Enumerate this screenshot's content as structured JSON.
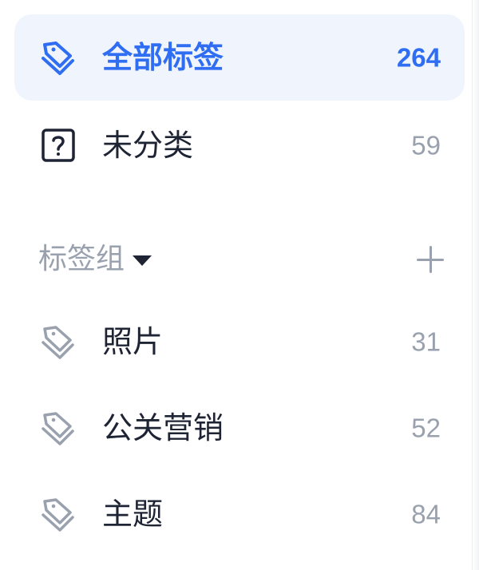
{
  "colors": {
    "accent": "#2f6df2",
    "active_bg": "#f0f5fd",
    "text_primary": "#1e2433",
    "text_muted": "#9aa1ae"
  },
  "all_tags": {
    "label": "全部标签",
    "count": "264",
    "icon": "tag-stack-icon",
    "active": true
  },
  "uncategorized": {
    "label": "未分类",
    "count": "59",
    "icon": "question-box-icon"
  },
  "tag_group": {
    "title": "标签组",
    "toggle_icon": "caret-down-icon",
    "add_icon": "plus-icon",
    "items": [
      {
        "label": "照片",
        "count": "31",
        "icon": "tag-stack-icon"
      },
      {
        "label": "公关营销",
        "count": "52",
        "icon": "tag-stack-icon"
      },
      {
        "label": "主题",
        "count": "84",
        "icon": "tag-stack-icon"
      }
    ]
  }
}
